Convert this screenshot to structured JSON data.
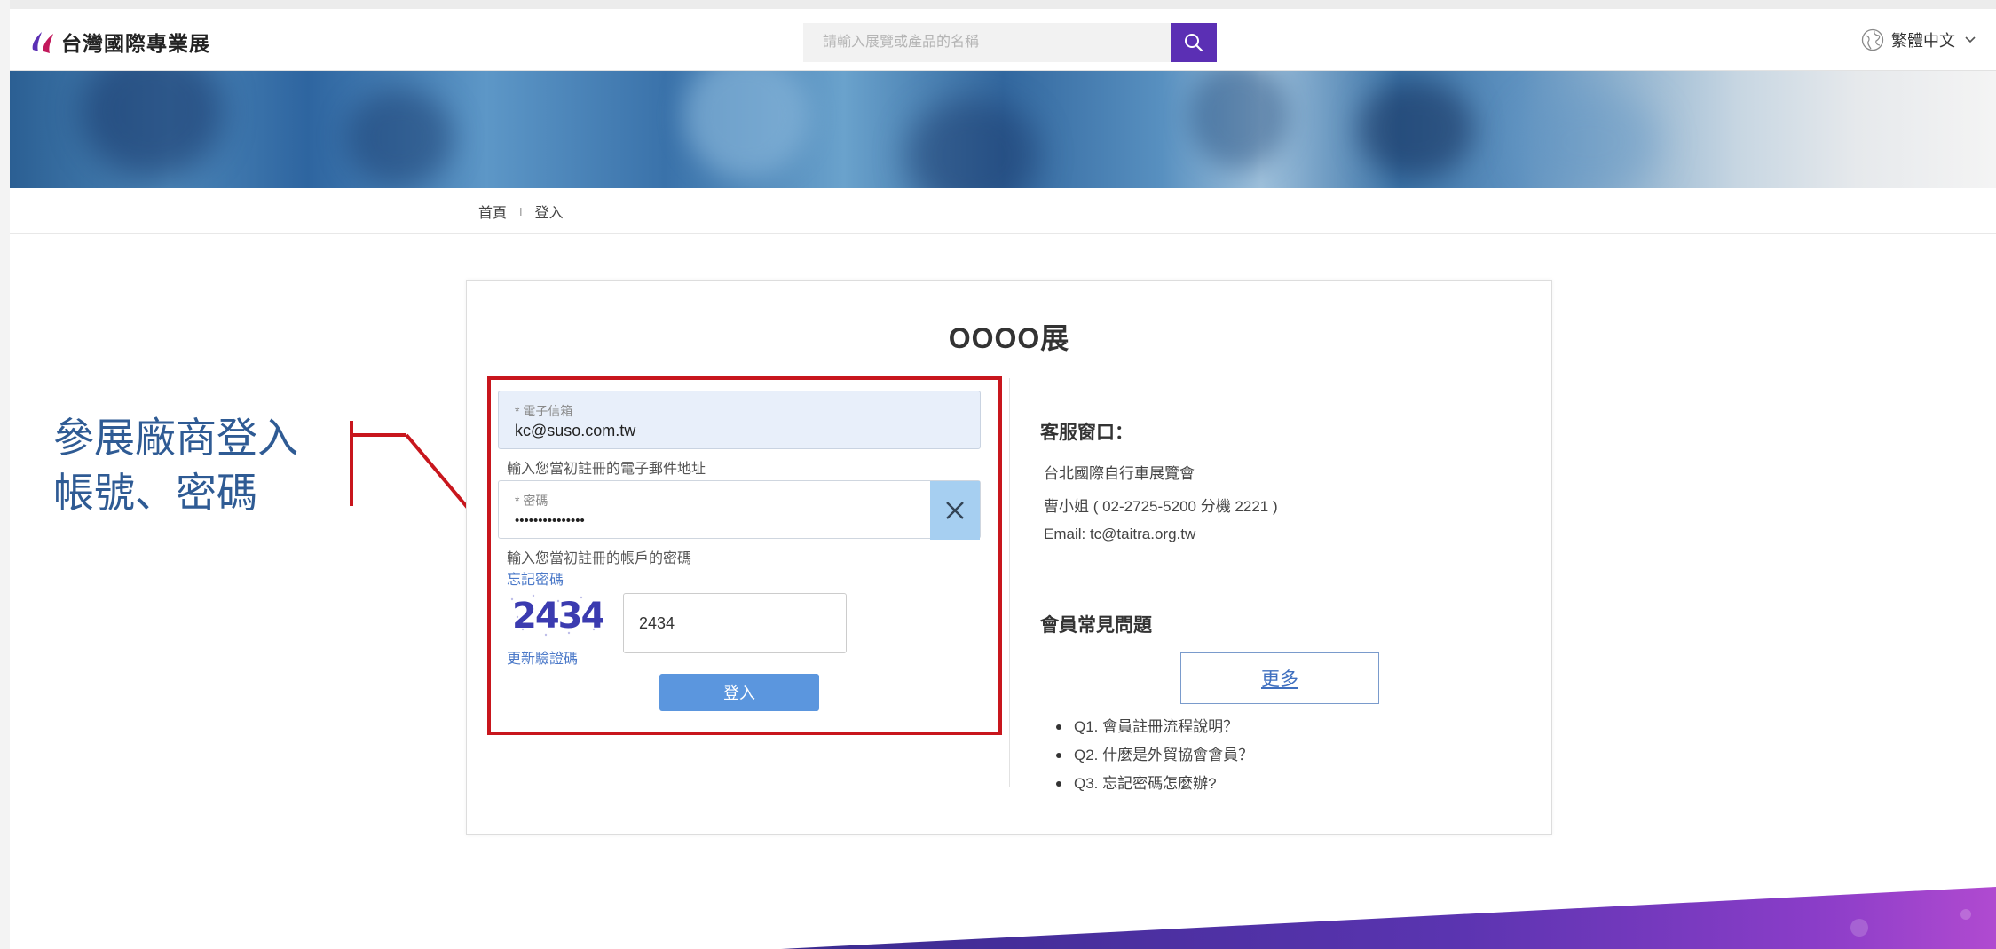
{
  "header": {
    "logo_text": "台灣國際專業展",
    "search_placeholder": "請輸入展覽或產品的名稱",
    "language": "繁體中文"
  },
  "breadcrumb": {
    "home": "首頁",
    "separator": "I",
    "current": "登入"
  },
  "annotation": {
    "line1": "參展廠商登入",
    "line2": "帳號、密碼",
    "color": "#2f5b94",
    "highlight_color": "#c8161d"
  },
  "card": {
    "title": "OOOO展"
  },
  "login_form": {
    "email_label": "* 電子信箱",
    "email_value": "kc@suso.com.tw",
    "email_hint": "輸入您當初註冊的電子郵件地址",
    "password_label": "* 密碼",
    "password_value": "•••••••••••••••",
    "password_hint": "輸入您當初註冊的帳戶的密碼",
    "forgot_password": "忘記密碼",
    "captcha_text": "2434",
    "captcha_value": "2434",
    "refresh_captcha": "更新驗證碼",
    "login_button": "登入"
  },
  "service": {
    "title": "客服窗口：",
    "org": "台北國際自行車展覽會",
    "contact": "曹小姐 ( 02-2725-5200 分機 2221 )",
    "email": "Email: tc@taitra.org.tw"
  },
  "faq": {
    "title": "會員常見問題",
    "more_button": "更多",
    "items": [
      "Q1. 會員註冊流程說明？",
      "Q2. 什麼是外貿協會會員？",
      "Q3. 忘記密碼怎麼辦?"
    ]
  },
  "colors": {
    "accent_purple": "#5b2fb4",
    "login_button": "#5b96de",
    "link_blue": "#4a78c8"
  },
  "icons": {
    "search": "search-icon",
    "globe": "globe-icon",
    "chevron": "chevron-down-icon",
    "clear": "close-icon",
    "logo": "logo-icon"
  }
}
